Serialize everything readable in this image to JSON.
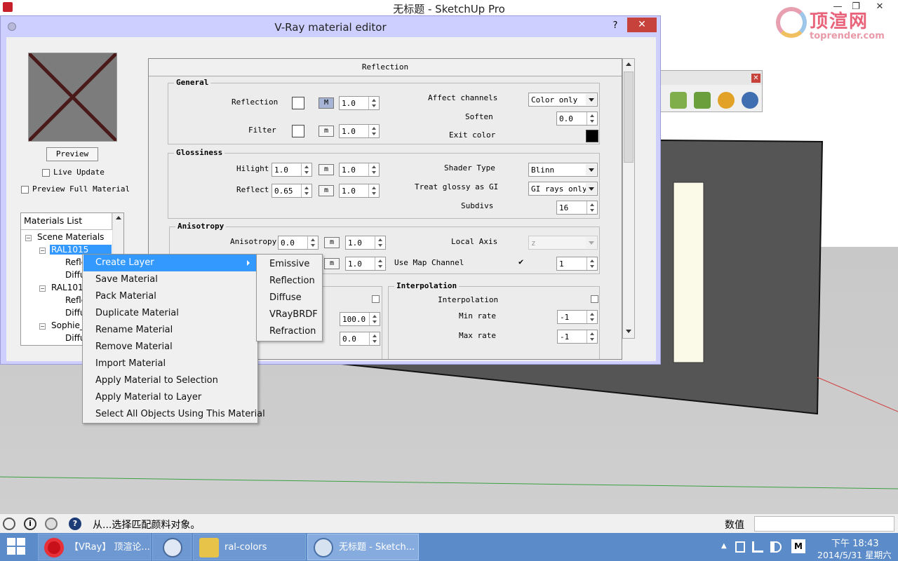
{
  "window": {
    "title": "无标题 - SketchUp Pro",
    "min": "—",
    "max": "❐",
    "close": "✕"
  },
  "watermark": {
    "brand": "顶渲网",
    "url": "toprender.com"
  },
  "vray_toolbar": {
    "close": "✕",
    "icons": [
      "vray-render-icon",
      "vray-rt-render-icon",
      "vray-frame-buffer-icon",
      "vray-interactive-icon"
    ]
  },
  "editor": {
    "title": "V-Ray material editor",
    "help": "?",
    "close": "✕",
    "preview_button": "Preview",
    "live_update": "Live Update",
    "preview_full": "Preview Full Material",
    "materials_list": {
      "header": "Materials List",
      "root": "Scene Materials",
      "items": [
        {
          "label": "RAL1015",
          "level": 1,
          "selected": true
        },
        {
          "label": "Refle",
          "level": 2
        },
        {
          "label": "Diffu",
          "level": 2
        },
        {
          "label": "RAL101",
          "level": 1
        },
        {
          "label": "Refle",
          "level": 2
        },
        {
          "label": "Diffu",
          "level": 2
        },
        {
          "label": "Sophie_",
          "level": 1
        },
        {
          "label": "Diffu",
          "level": 2
        }
      ]
    },
    "reflection": {
      "header": "Reflection",
      "general": {
        "title": "General",
        "reflection_label": "Reflection",
        "reflection_m": "M",
        "reflection_value": "1.0",
        "filter_label": "Filter",
        "filter_m": "m",
        "filter_value": "1.0",
        "affect_channels_label": "Affect channels",
        "affect_channels_value": "Color only",
        "soften_label": "Soften",
        "soften_value": "0.0",
        "exit_color_label": "Exit color"
      },
      "glossiness": {
        "title": "Glossiness",
        "hilight_label": "Hilight",
        "hilight_value": "1.0",
        "hilight_m": "m",
        "hilight_mult": "1.0",
        "reflect_label": "Reflect",
        "reflect_value": "0.65",
        "reflect_m": "m",
        "reflect_mult": "1.0",
        "shader_type_label": "Shader Type",
        "shader_type_value": "Blinn",
        "treat_glossy_label": "Treat glossy as GI",
        "treat_glossy_value": "GI rays only",
        "subdivs_label": "Subdivs",
        "subdivs_value": "16"
      },
      "anisotropy": {
        "title": "Anisotropy",
        "anisotropy_label": "Anisotropy",
        "anisotropy_value": "0.0",
        "anisotropy_m": "m",
        "anisotropy_mult": "1.0",
        "rotation_m": "m",
        "rotation_mult": "1.0",
        "local_axis_label": "Local Axis",
        "local_axis_value": "z",
        "use_map_channel_label": "Use Map Channel",
        "map_channel_value": "1"
      },
      "lower": {
        "value_100": "100.0",
        "value_partial": "0.0"
      },
      "interpolation": {
        "title": "Interpolation",
        "interpolation_label": "Interpolation",
        "min_rate_label": "Min rate",
        "min_rate_value": "-1",
        "max_rate_label": "Max rate",
        "max_rate_value": "-1"
      }
    }
  },
  "context_menu": {
    "items": [
      "Create Layer",
      "Save Material",
      "Pack Material",
      "Duplicate Material",
      "Rename Material",
      "Remove Material",
      "Import Material",
      "Apply Material to Selection",
      "Apply Material to Layer",
      "Select All Objects Using This Material"
    ],
    "highlighted": "Create Layer"
  },
  "submenu": {
    "items": [
      "Emissive",
      "Reflection",
      "Diffuse",
      "VRayBRDF",
      "Refraction"
    ]
  },
  "statusbar": {
    "icons": [
      "info-icon",
      "instructor-icon",
      "user-icon",
      "help-icon"
    ],
    "help_glyph": "?",
    "info_glyph": "i",
    "message": "从...选择匹配颜料对象。",
    "measurements_label": "数值",
    "measurements_value": ""
  },
  "taskbar": {
    "apps": [
      {
        "label": "【VRay】 顶渲论...",
        "icon": "opera-icon"
      },
      {
        "label": "",
        "icon": "search-icon"
      },
      {
        "label": "ral-colors",
        "icon": "folder-icon"
      },
      {
        "label": "无标题 - Sketch...",
        "icon": "sketchup-icon",
        "active": true
      }
    ],
    "tray": {
      "arrow": "▲",
      "ime": "M",
      "time": "下午 18:43",
      "date": "2014/5/31 星期六"
    }
  },
  "colors": {
    "editor_title_bg": "#cccfff",
    "close_red": "#c7423a",
    "menu_highlight": "#3399ff",
    "taskbar": "#5b8bc8",
    "box_face": "#555555",
    "box_inner": "#fbfae9"
  }
}
